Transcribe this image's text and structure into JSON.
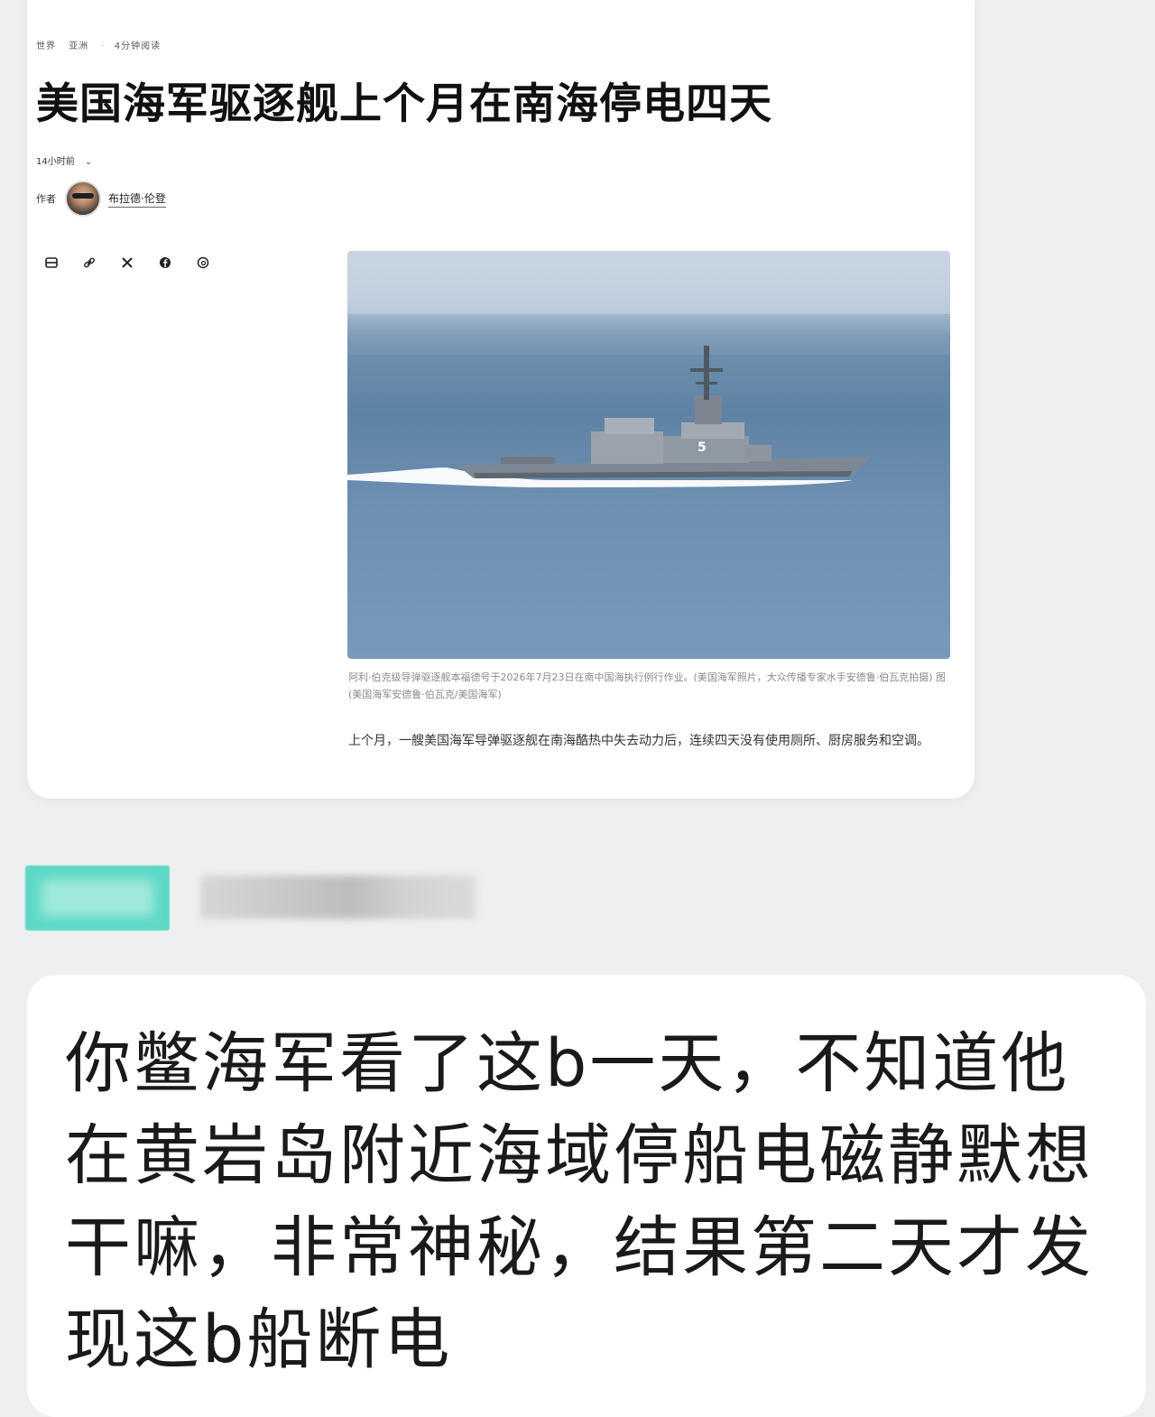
{
  "article": {
    "breadcrumb_section": "世界",
    "breadcrumb_region": "亚洲",
    "read_time": "4分钟阅读",
    "headline": "美国海军驱逐舰上个月在南海停电四天",
    "timestamp": "14小时前",
    "author_prefix": "作者",
    "author_name": "布拉德·伦登",
    "share_icons": [
      "bookmark-icon",
      "link-icon",
      "x-icon",
      "facebook-icon",
      "threads-icon"
    ],
    "photo_alt": "destroyer-at-sea",
    "caption": "阿利·伯克级导弹驱逐舰本福德号于2026年7月23日在南中国海执行例行作业。(美国海军照片，大众传播专家水手安德鲁·伯瓦克拍摄) 图(美国海军安德鲁·伯瓦克/美国海军)",
    "body": "上个月，一艘美国海军导弹驱逐舰在南海酷热中失去动力后，连续四天没有使用厕所、厨房服务和空调。"
  },
  "comment": {
    "text": "你鳖海军看了这b一天，不知道他在黄岩岛附近海域停船电磁静默想干嘛，非常神秘，结果第二天才发现这b船断电"
  },
  "colors": {
    "page_bg": "#eeeff1",
    "card_bg": "#ffffff",
    "username_tag": "#5ed9c6",
    "sea": "#6d8fb1"
  }
}
